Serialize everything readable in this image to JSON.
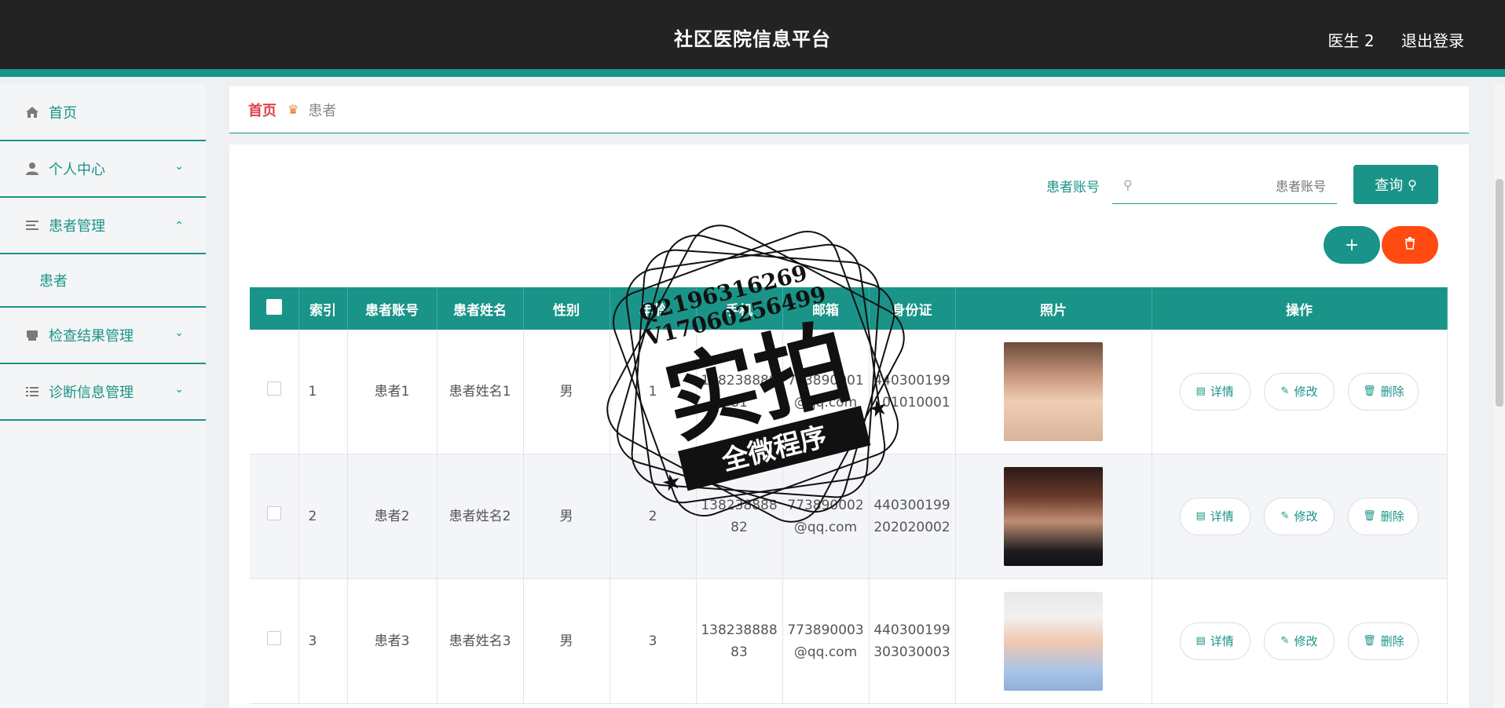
{
  "app": {
    "title": "社区医院信息平台"
  },
  "user": {
    "name": "医生 2",
    "logout": "退出登录"
  },
  "sidebar": {
    "items": [
      {
        "label": "首页",
        "icon": "home-icon"
      },
      {
        "label": "个人中心",
        "icon": "user-icon",
        "expanded": false
      },
      {
        "label": "患者管理",
        "icon": "list-icon",
        "expanded": true,
        "children": [
          {
            "label": "患者"
          }
        ]
      },
      {
        "label": "检查结果管理",
        "icon": "printer-icon",
        "expanded": false
      },
      {
        "label": "诊断信息管理",
        "icon": "list-lines-icon",
        "expanded": false
      }
    ]
  },
  "breadcrumb": {
    "home": "首页",
    "current": "患者"
  },
  "search": {
    "label": "患者账号",
    "placeholder": "患者账号",
    "button": "查询"
  },
  "table": {
    "columns": [
      "",
      "索引",
      "患者账号",
      "患者姓名",
      "性别",
      "年龄",
      "手机",
      "邮箱",
      "身份证",
      "照片",
      "操作"
    ],
    "rows": [
      {
        "index": "1",
        "account": "患者1",
        "name": "患者姓名1",
        "gender": "男",
        "age": "1",
        "phone": "13823888881",
        "email": "773890001@qq.com",
        "idcard": "440300199101010001"
      },
      {
        "index": "2",
        "account": "患者2",
        "name": "患者姓名2",
        "gender": "男",
        "age": "2",
        "phone": "13823888882",
        "email": "773890002@qq.com",
        "idcard": "440300199202020002"
      },
      {
        "index": "3",
        "account": "患者3",
        "name": "患者姓名3",
        "gender": "男",
        "age": "3",
        "phone": "13823888883",
        "email": "773890003@qq.com",
        "idcard": "440300199303030003"
      }
    ],
    "actions": {
      "detail": "详情",
      "edit": "修改",
      "delete": "删除"
    }
  },
  "watermark": {
    "line1": "Q2196316269",
    "line2": "V17060256499",
    "main": "实拍",
    "sub": "全微程序"
  },
  "colors": {
    "accent": "#1a9488",
    "danger": "#ff4a12",
    "header_bg": "#232323",
    "breadcrumb_home": "#e0404a"
  }
}
